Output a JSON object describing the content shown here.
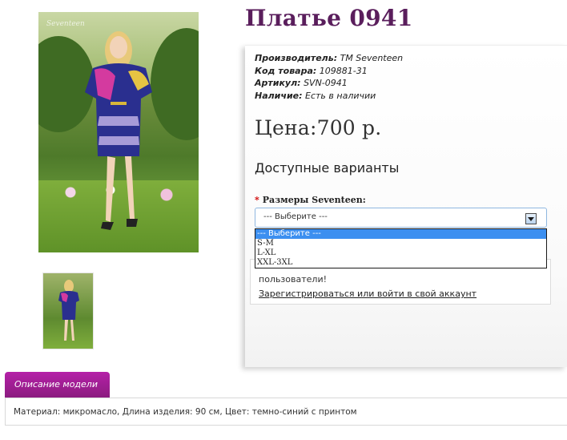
{
  "product": {
    "title": "Платье 0941",
    "specs": [
      {
        "label": "Производитель:",
        "value": "TM Seventeen"
      },
      {
        "label": "Код товара:",
        "value": "109881-31"
      },
      {
        "label": "Артикул:",
        "value": "SVN-0941"
      },
      {
        "label": "Наличие:",
        "value": "Есть в наличии"
      }
    ],
    "price": "Цена:700 р.",
    "image_watermark": "Seventeen"
  },
  "options": {
    "title": "Доступные варианты",
    "size_label": "Размеры Seventeen:",
    "required_mark": "*",
    "select_value": "--- Выберите ---",
    "dropdown_items": [
      "--- Выберите ---",
      "S-M",
      "L-XL",
      "XXL-3XL"
    ]
  },
  "login_notice": {
    "text": "пользователи!",
    "link": "Зарегистрироваться или войти в свой аккаунт"
  },
  "description": {
    "tab_label": "Описание модели",
    "text": "Материал: микромасло, Длина изделия: 90 см, Цвет: темно-синий с принтом"
  },
  "colors": {
    "title": "#5a1e5c",
    "tab": "#a01e93",
    "dropdown_highlight": "#3c8ff0"
  }
}
